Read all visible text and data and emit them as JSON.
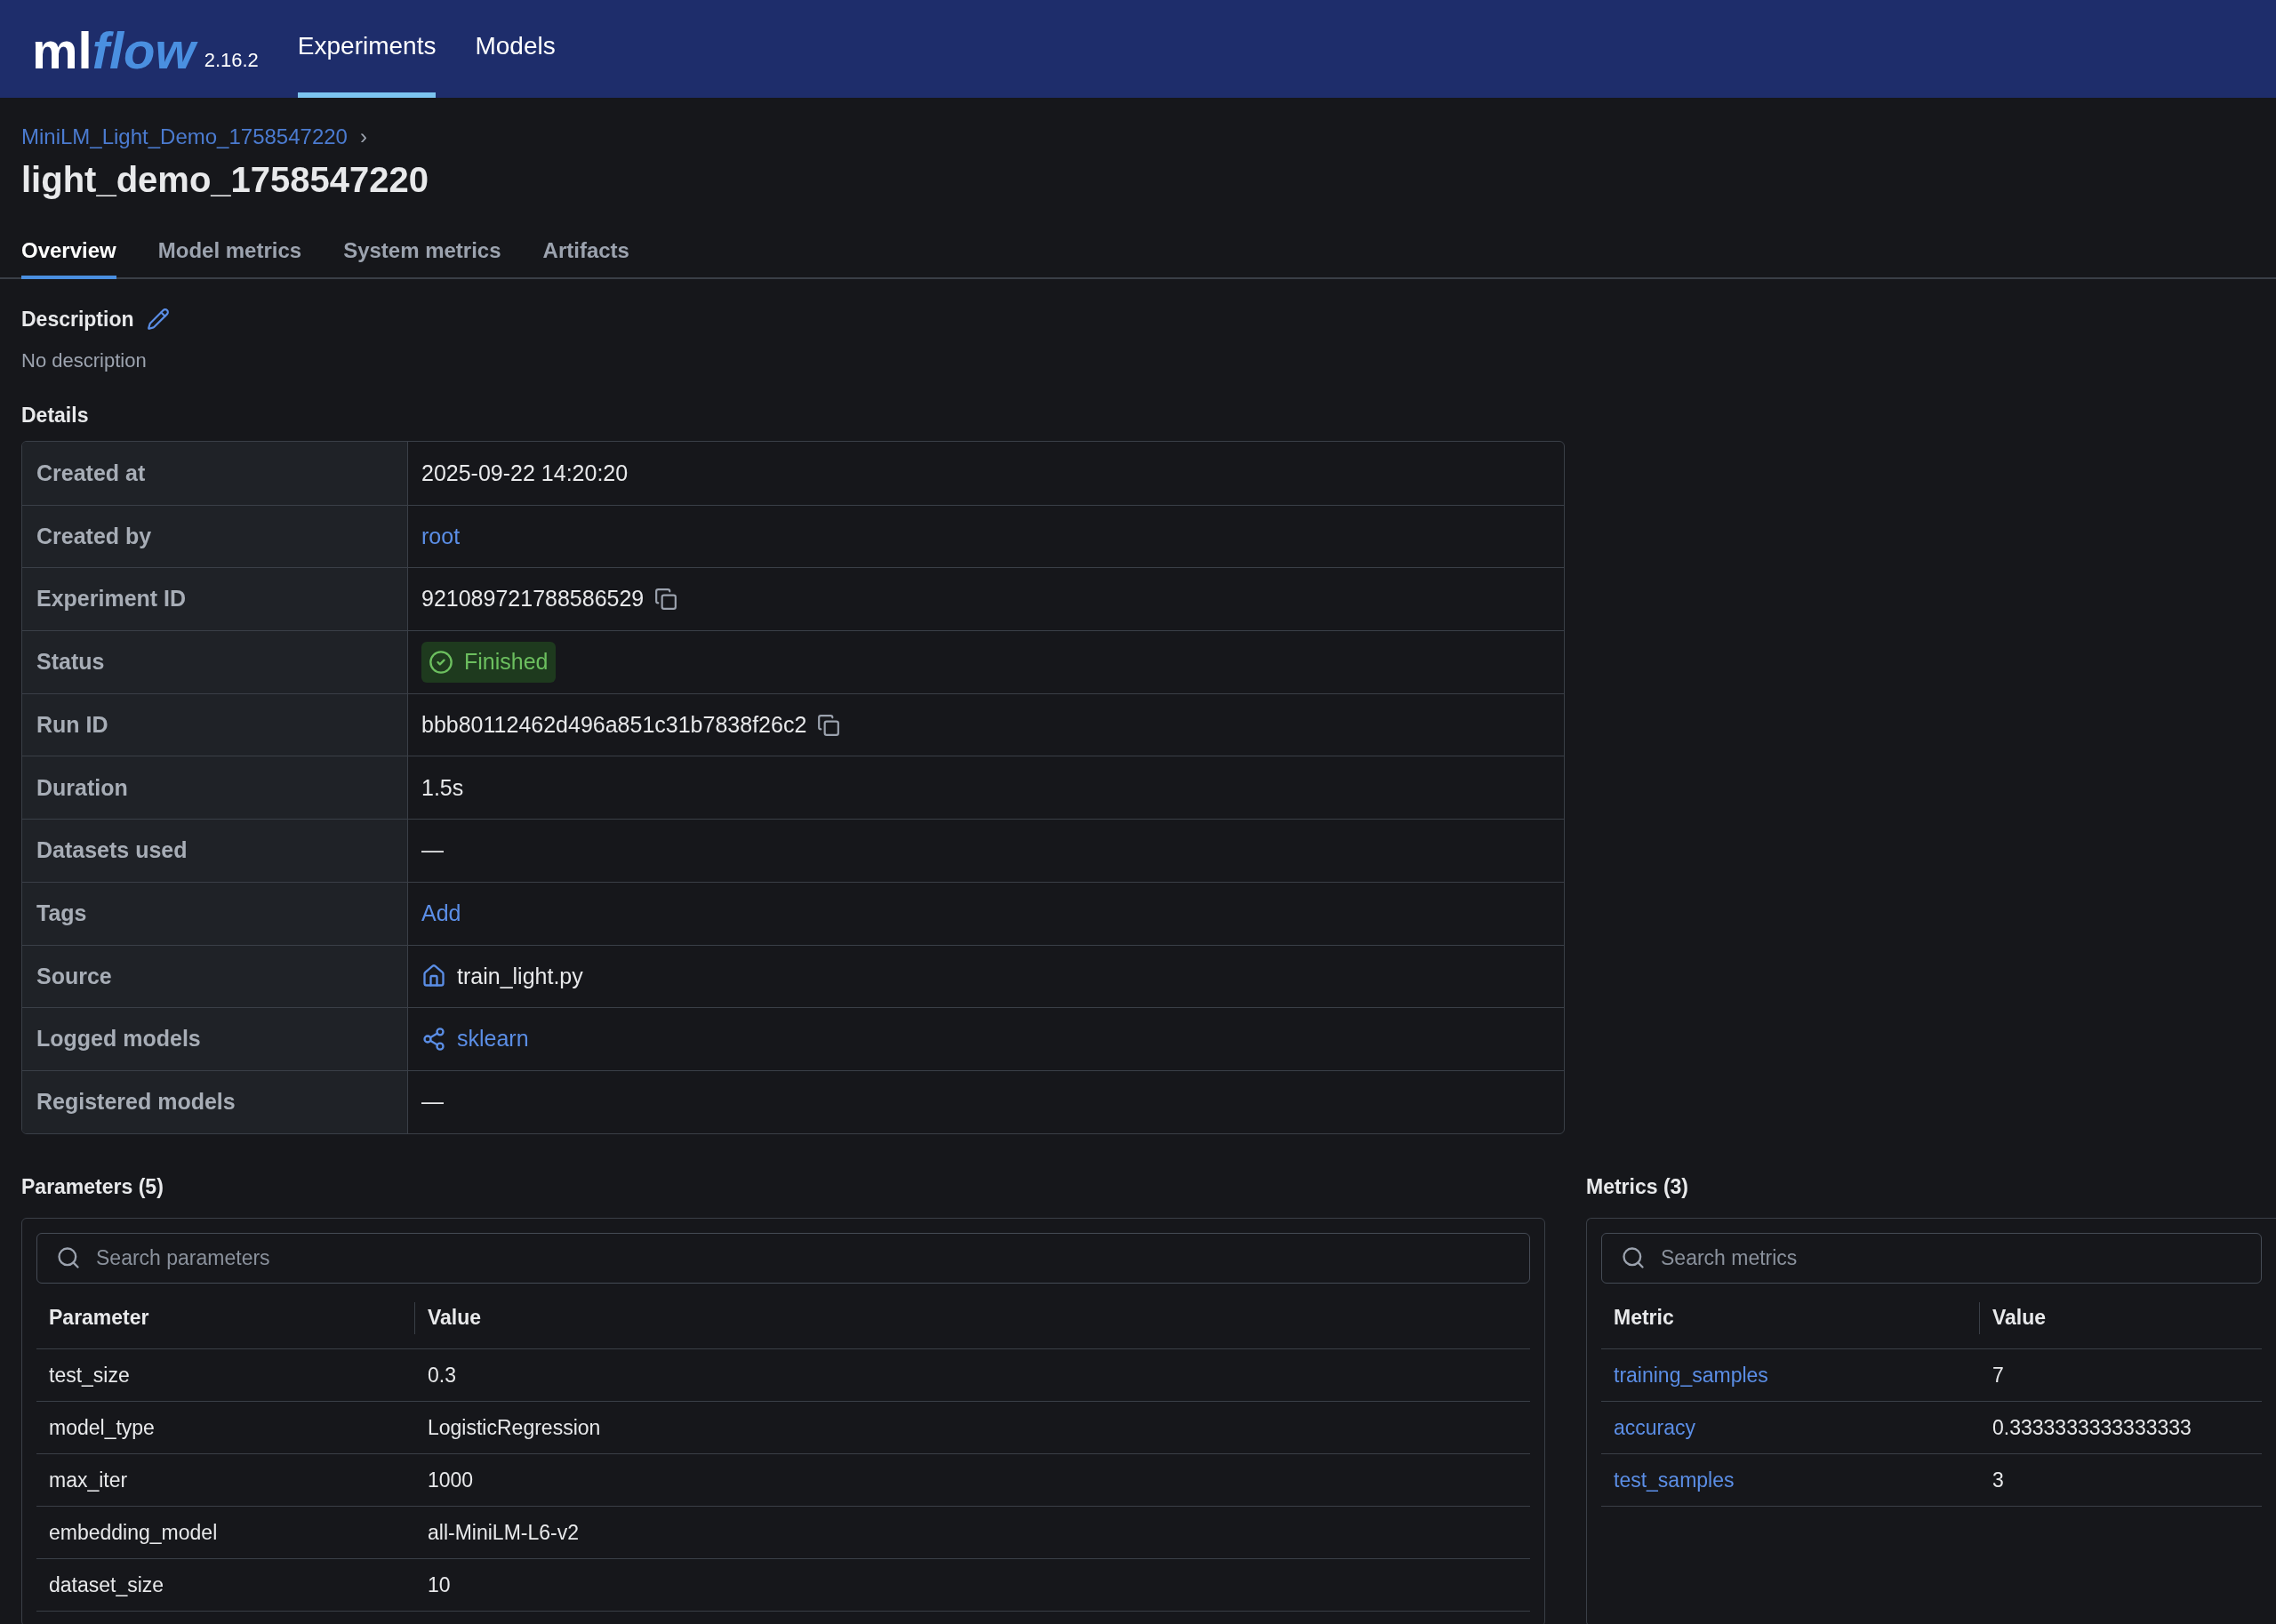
{
  "header": {
    "logo": {
      "part_1": "ml",
      "part_2": "flow"
    },
    "version": "2.16.2",
    "nav": [
      {
        "label": "Experiments",
        "selected": true
      },
      {
        "label": "Models",
        "selected": false
      }
    ]
  },
  "breadcrumb": {
    "parent": "MiniLM_Light_Demo_1758547220",
    "separator": "›"
  },
  "title": "light_demo_1758547220",
  "tabs": [
    {
      "label": "Overview",
      "selected": true
    },
    {
      "label": "Model metrics",
      "selected": false
    },
    {
      "label": "System metrics",
      "selected": false
    },
    {
      "label": "Artifacts",
      "selected": false
    }
  ],
  "description": {
    "heading": "Description",
    "text": "No description"
  },
  "details": {
    "heading": "Details",
    "rows": [
      {
        "label": "Created at",
        "kind": "text",
        "value": "2025-09-22 14:20:20"
      },
      {
        "label": "Created by",
        "kind": "link",
        "value": "root"
      },
      {
        "label": "Experiment ID",
        "kind": "copy",
        "value": "921089721788586529"
      },
      {
        "label": "Status",
        "kind": "status",
        "value": "Finished"
      },
      {
        "label": "Run ID",
        "kind": "copy",
        "value": "bbb80112462d496a851c31b7838f26c2"
      },
      {
        "label": "Duration",
        "kind": "text",
        "value": "1.5s"
      },
      {
        "label": "Datasets used",
        "kind": "text",
        "value": "—"
      },
      {
        "label": "Tags",
        "kind": "link",
        "value": "Add"
      },
      {
        "label": "Source",
        "kind": "source",
        "value": "train_light.py"
      },
      {
        "label": "Logged models",
        "kind": "model",
        "value": "sklearn"
      },
      {
        "label": "Registered models",
        "kind": "text",
        "value": "—"
      }
    ]
  },
  "parameters": {
    "heading": "Parameters (5)",
    "placeholder": "Search parameters",
    "columns": [
      "Parameter",
      "Value"
    ],
    "rows": [
      {
        "name": "test_size",
        "value": "0.3"
      },
      {
        "name": "model_type",
        "value": "LogisticRegression"
      },
      {
        "name": "max_iter",
        "value": "1000"
      },
      {
        "name": "embedding_model",
        "value": "all-MiniLM-L6-v2"
      },
      {
        "name": "dataset_size",
        "value": "10"
      }
    ]
  },
  "metrics": {
    "heading": "Metrics (3)",
    "placeholder": "Search metrics",
    "columns": [
      "Metric",
      "Value"
    ],
    "rows": [
      {
        "name": "training_samples",
        "value": "7"
      },
      {
        "name": "accuracy",
        "value": "0.3333333333333333"
      },
      {
        "name": "test_samples",
        "value": "3"
      }
    ]
  }
}
